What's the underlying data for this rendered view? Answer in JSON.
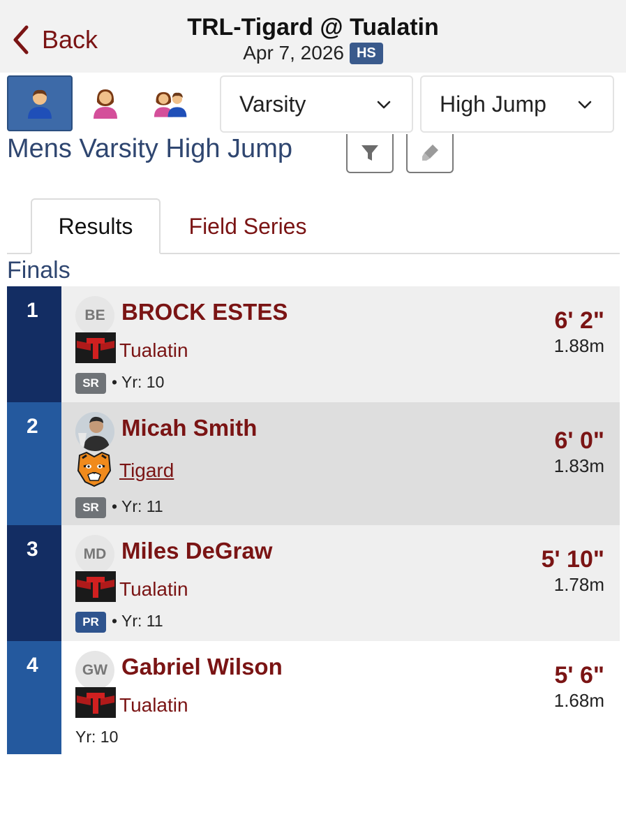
{
  "header": {
    "back_label": "Back",
    "title": "TRL-Tigard @ Tualatin",
    "date": "Apr 7, 2026",
    "level_badge": "HS"
  },
  "filters": {
    "gender_options": [
      "male-athlete-icon",
      "female-athlete-icon",
      "mixed-athletes-icon"
    ],
    "division": "Varsity",
    "event": "High Jump"
  },
  "event_title": "Mens Varsity High Jump",
  "tabs": [
    {
      "label": "Results",
      "active": true
    },
    {
      "label": "Field Series",
      "active": false
    }
  ],
  "section": "Finals",
  "results": [
    {
      "place": "1",
      "initials": "BE",
      "name": "BROCK ESTES",
      "team": "Tualatin",
      "badge": "SR",
      "year": "Yr: 10",
      "mark": "6' 2\"",
      "metric": "1.88m"
    },
    {
      "place": "2",
      "initials": "",
      "name": "Micah Smith",
      "team": "Tigard",
      "badge": "SR",
      "year": "Yr: 11",
      "mark": "6' 0\"",
      "metric": "1.83m"
    },
    {
      "place": "3",
      "initials": "MD",
      "name": "Miles DeGraw",
      "team": "Tualatin",
      "badge": "PR",
      "year": "Yr: 11",
      "mark": "5' 10\"",
      "metric": "1.78m"
    },
    {
      "place": "4",
      "initials": "GW",
      "name": "Gabriel Wilson",
      "team": "Tualatin",
      "badge": "",
      "year": "Yr: 10",
      "mark": "5' 6\"",
      "metric": "1.68m"
    }
  ],
  "colors": {
    "accent": "#7a1414",
    "place_dark": "#132d63",
    "place_light": "#24599e",
    "row_bg": "#efefef",
    "row_highlight": "#dedede",
    "sr_badge": "#6f7377",
    "pr_badge": "#2f548e"
  }
}
